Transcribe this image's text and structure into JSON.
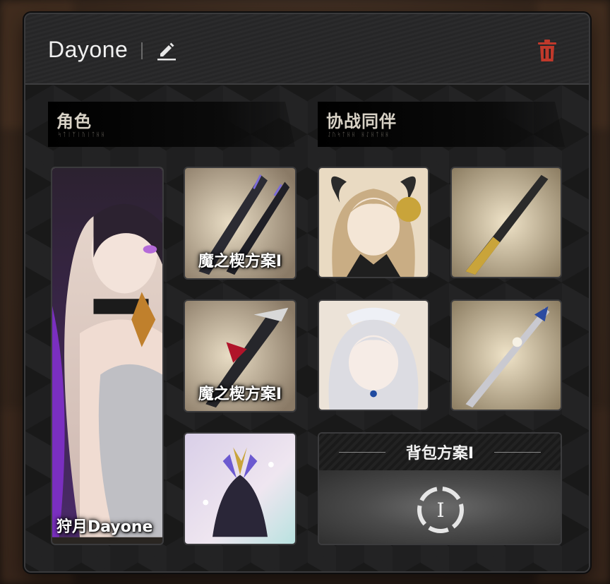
{
  "header": {
    "title": "Dayone",
    "edit_icon": "pencil-icon",
    "delete_icon": "trash-icon",
    "delete_color": "#c0392b"
  },
  "sections": {
    "character": {
      "title": "角色",
      "subtitle": "ᛋᛏᛁᛉᛁᚢᛁᛏᚺᚺ"
    },
    "companion": {
      "title": "协战同伴",
      "subtitle": "ᛇᚢᛋᛏᚺᚺ ᚺᛇᚺᛏᚺᚺ"
    }
  },
  "character_card": {
    "label": "狩月Dayone",
    "hair_color": "#2a1f2e",
    "accent": "#8a3bd6"
  },
  "weapon_cards": [
    {
      "label": "魔之楔方案Ⅰ"
    },
    {
      "label": "魔之楔方案Ⅰ"
    }
  ],
  "companions": [
    {
      "name": "companion-horned-girl"
    },
    {
      "name": "companion-white-haired-girl"
    }
  ],
  "backpack": {
    "title": "背包方案Ⅰ",
    "icon_glyph": "Ⅰ"
  }
}
